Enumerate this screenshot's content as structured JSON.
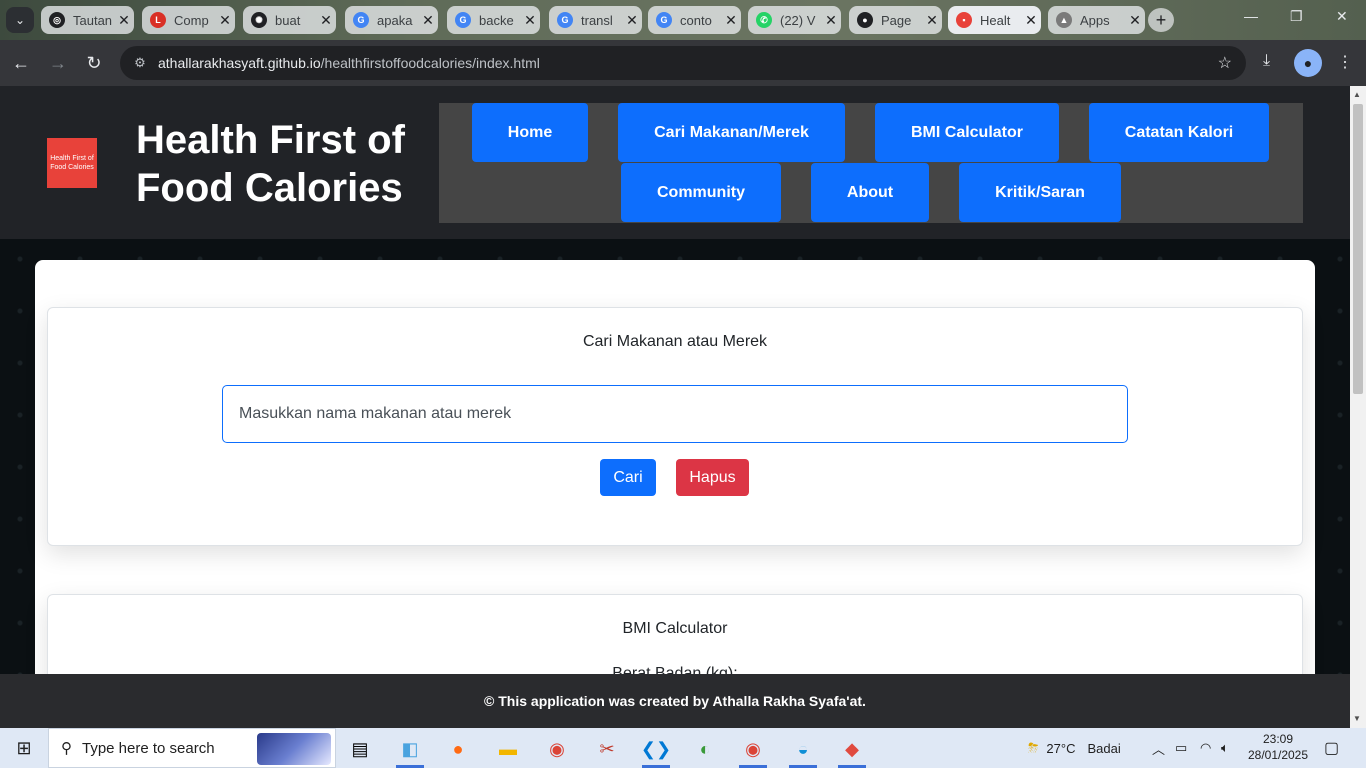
{
  "browser": {
    "tabs": [
      {
        "title": "Tautan",
        "favicon": "openai-icon",
        "color": "#202124",
        "glyph": "◎"
      },
      {
        "title": "Comp",
        "favicon": "le-icon",
        "color": "#d93025",
        "glyph": "L"
      },
      {
        "title": "buat",
        "favicon": "perplexity-icon",
        "color": "#202124",
        "glyph": "✺"
      },
      {
        "title": "apaka",
        "favicon": "google-icon",
        "color": "#4285f4",
        "glyph": "G"
      },
      {
        "title": "backe",
        "favicon": "google-icon",
        "color": "#4285f4",
        "glyph": "G"
      },
      {
        "title": "transl",
        "favicon": "google-icon",
        "color": "#4285f4",
        "glyph": "G"
      },
      {
        "title": "conto",
        "favicon": "google-icon",
        "color": "#4285f4",
        "glyph": "G"
      },
      {
        "title": "(22) V",
        "favicon": "whatsapp-icon",
        "color": "#25d366",
        "glyph": "✆"
      },
      {
        "title": "Page",
        "favicon": "github-icon",
        "color": "#202124",
        "glyph": "●"
      },
      {
        "title": "Healt",
        "favicon": "health-icon",
        "color": "#e8423a",
        "glyph": "▪"
      },
      {
        "title": "Apps",
        "favicon": "apps-icon",
        "color": "#7a7a7a",
        "glyph": "▲"
      }
    ],
    "url_host": "athallarakhasyaft.github.io",
    "url_path": "/healthfirstoffoodcalories/index.html"
  },
  "site": {
    "logo_text": "Health First of Food Calories",
    "title": "Health First of Food Calories",
    "nav": [
      "Home",
      "Cari Makanan/Merek",
      "BMI Calculator",
      "Catatan Kalori",
      "Community",
      "About",
      "Kritik/Saran"
    ]
  },
  "search_section": {
    "heading": "Cari Makanan atau Merek",
    "placeholder": "Masukkan nama makanan atau merek",
    "search_button": "Cari",
    "clear_button": "Hapus",
    "search_color": "#0d6efd",
    "clear_color": "#dc3545"
  },
  "bmi_section": {
    "heading": "BMI Calculator",
    "weight_label": "Berat Badan (kg):"
  },
  "footer": {
    "text": "© This application was created by Athalla Rakha Syafa'at."
  },
  "taskbar": {
    "search_placeholder": "Type here to search",
    "weather_temp": "27°C",
    "weather_desc": "Badai",
    "time": "23:09",
    "date": "28/01/2025"
  }
}
